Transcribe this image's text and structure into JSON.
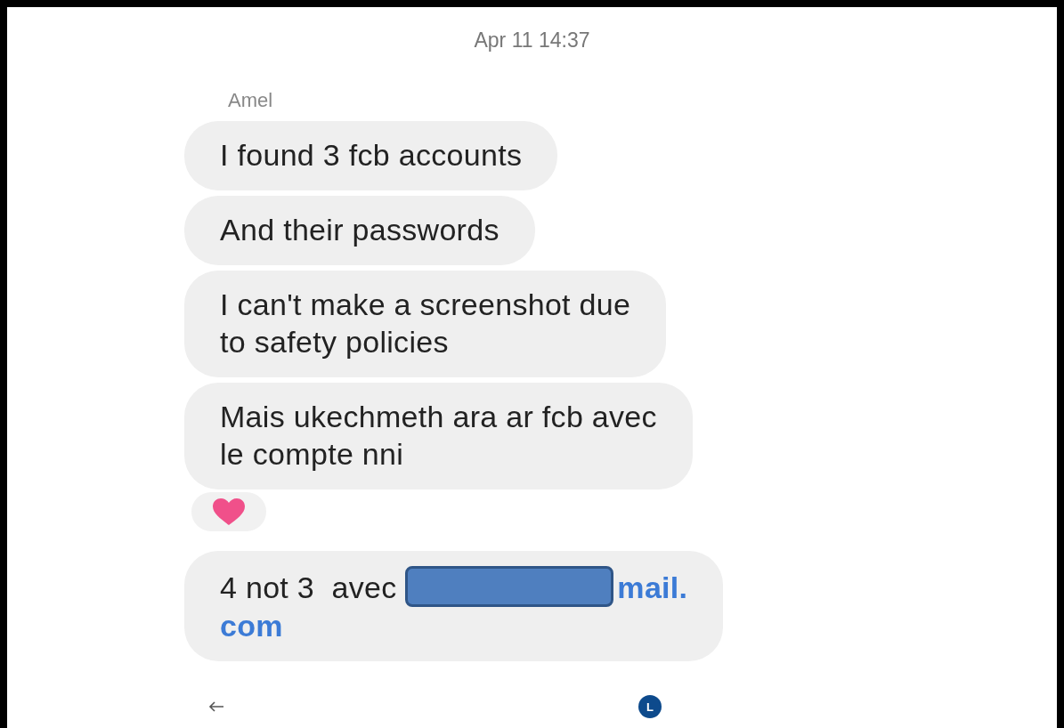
{
  "timestamp": "Apr 11 14:37",
  "sender": "Amel",
  "messages": [
    {
      "kind": "text",
      "lines": [
        "I found 3 fcb accounts"
      ]
    },
    {
      "kind": "text",
      "lines": [
        "And their passwords"
      ]
    },
    {
      "kind": "text",
      "lines": [
        "I can't make a screenshot due",
        "to safety policies"
      ]
    },
    {
      "kind": "text",
      "lines": [
        "Mais ukechmeth ara ar fcb avec",
        "le compte nni"
      ],
      "heart_reaction": true
    },
    {
      "kind": "email",
      "text": "4 not 3  avec",
      "redacted": true,
      "link_lines": [
        "mail.",
        "com"
      ]
    }
  ],
  "avatar": {
    "letter": "L"
  }
}
